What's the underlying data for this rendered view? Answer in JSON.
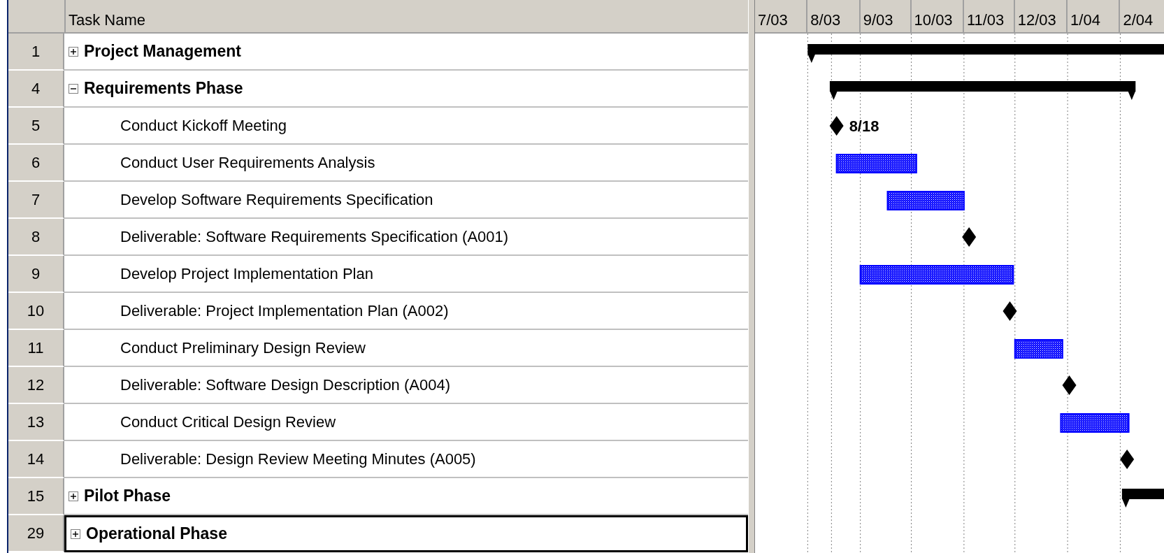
{
  "table": {
    "columns": [
      "Task Name"
    ]
  },
  "timescale": [
    "7/03",
    "8/03",
    "9/03",
    "10/03",
    "11/03",
    "12/03",
    "1/04",
    "2/04"
  ],
  "tasks": [
    {
      "id": "1",
      "name": "Project Management",
      "kind": "summary",
      "expanded": false,
      "selected": false
    },
    {
      "id": "4",
      "name": "Requirements Phase",
      "kind": "summary",
      "expanded": true,
      "selected": false,
      "children": [
        {
          "id": "5",
          "name": "Conduct Kickoff Meeting",
          "kind": "milestone",
          "selected": false,
          "label": "8/18"
        },
        {
          "id": "6",
          "name": "Conduct User Requirements Analysis",
          "kind": "task",
          "selected": false
        },
        {
          "id": "7",
          "name": "Develop Software Requirements Specification",
          "kind": "task",
          "selected": false
        },
        {
          "id": "8",
          "name": "Deliverable:  Software Requirements Specification (A001)",
          "kind": "milestone",
          "selected": false
        },
        {
          "id": "9",
          "name": "Develop Project Implementation Plan",
          "kind": "task",
          "selected": false
        },
        {
          "id": "10",
          "name": "Deliverable: Project Implementation Plan (A002)",
          "kind": "milestone",
          "selected": false
        },
        {
          "id": "11",
          "name": "Conduct Preliminary Design Review",
          "kind": "task",
          "selected": false
        },
        {
          "id": "12",
          "name": "Deliverable: Software Design Description (A004)",
          "kind": "milestone",
          "selected": false
        },
        {
          "id": "13",
          "name": "Conduct Critical Design Review",
          "kind": "task",
          "selected": false
        },
        {
          "id": "14",
          "name": "Deliverable: Design Review Meeting Minutes (A005)",
          "kind": "milestone",
          "selected": false
        }
      ]
    },
    {
      "id": "15",
      "name": "Pilot Phase",
      "kind": "summary",
      "expanded": false,
      "selected": false
    },
    {
      "id": "29",
      "name": "Operational Phase",
      "kind": "summary",
      "expanded": false,
      "selected": true
    }
  ]
}
